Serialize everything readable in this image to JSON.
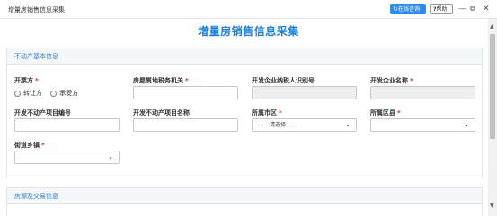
{
  "window": {
    "title": "增量房销售信息采集",
    "online_consult_label": "在线咨询",
    "help_label": "帮助",
    "help_icon_glyph": "?",
    "minimize_glyph": "—",
    "maximize_glyph": "⧉",
    "close_glyph": "✕"
  },
  "page": {
    "title": "增量房销售信息采集"
  },
  "section_basic": {
    "title": "不动产基本信息",
    "fields": {
      "kaipiao_fang": {
        "label": "开票方",
        "required": "*",
        "options": [
          "转让方",
          "承受方"
        ]
      },
      "tax_office": {
        "label": "房屋属地税务机关",
        "required": "*",
        "value": ""
      },
      "taxpayer_id": {
        "label": "开发企业纳税人识别号",
        "value": ""
      },
      "company_name": {
        "label": "开发企业名称",
        "required": "*",
        "value": ""
      },
      "project_number": {
        "label": "开发不动产项目编号",
        "value": ""
      },
      "project_name": {
        "label": "开发不动产项目名称",
        "value": ""
      },
      "city": {
        "label": "所属市区",
        "required": "*",
        "selected": "------请选择------"
      },
      "district": {
        "label": "所属区县",
        "required": "*",
        "selected": ""
      },
      "street": {
        "label": "街道乡镇",
        "required": "*",
        "selected": ""
      }
    }
  },
  "section_transaction": {
    "title": "房源及交易信息"
  },
  "icons": {
    "refresh": "refresh-icon",
    "chevron": "chevron-down-icon"
  },
  "colors": {
    "accent": "#1f7fd8",
    "button": "#2d8cf0",
    "required": "#e02020"
  }
}
